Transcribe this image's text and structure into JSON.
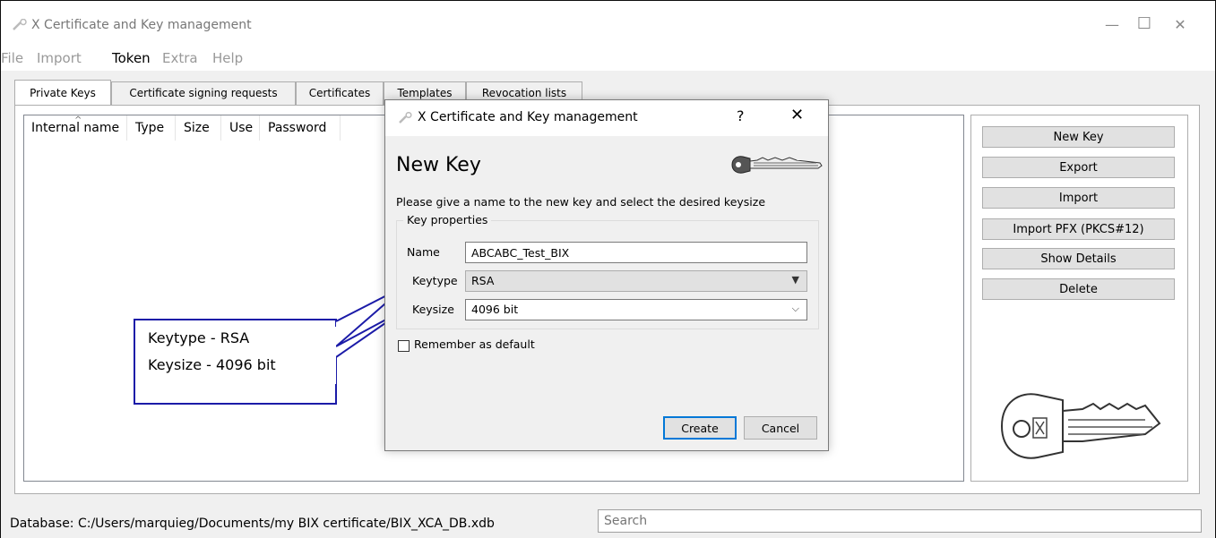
{
  "window": {
    "title": "X Certificate and Key management",
    "controls": {
      "minimize": "—",
      "maximize": "☐",
      "close": "✕"
    }
  },
  "menu": [
    "File",
    "Import",
    "Token",
    "Extra",
    "Help"
  ],
  "tabs": [
    {
      "label": "Private Keys",
      "active": true
    },
    {
      "label": "Certificate signing requests",
      "active": false
    },
    {
      "label": "Certificates",
      "active": false
    },
    {
      "label": "Templates",
      "active": false
    },
    {
      "label": "Revocation lists",
      "active": false
    }
  ],
  "table": {
    "columns": [
      "Internal name",
      "Type",
      "Size",
      "Use",
      "Password"
    ],
    "rows": []
  },
  "side_buttons": [
    "New Key",
    "Export",
    "Import",
    "Import PFX (PKCS#12)",
    "Show Details",
    "Delete"
  ],
  "status": {
    "database": "Database: C:/Users/marquieg/Documents/my BIX certificate/BIX_XCA_DB.xdb",
    "search_placeholder": "Search"
  },
  "callout": {
    "line1": "Keytype - RSA",
    "line2": "Keysize - 4096 bit"
  },
  "dialog": {
    "title": "X Certificate and Key management",
    "help": "?",
    "close": "✕",
    "heading": "New Key",
    "description": "Please give a name to the new key and select the desired keysize",
    "group_label": "Key properties",
    "name_label": "Name",
    "name_value": "ABCABC_Test_BIX",
    "keytype_label": "Keytype",
    "keytype_value": "RSA",
    "keysize_label": "Keysize",
    "keysize_value": "4096 bit",
    "remember_label": "Remember as default",
    "remember_checked": false,
    "create_label": "Create",
    "cancel_label": "Cancel"
  },
  "icons": {
    "app": "key-icon",
    "dialog_key": "key-icon",
    "side_key": "bix-key-icon"
  },
  "colors": {
    "accent": "#0078d7",
    "callout_border": "#1b1ba8"
  }
}
